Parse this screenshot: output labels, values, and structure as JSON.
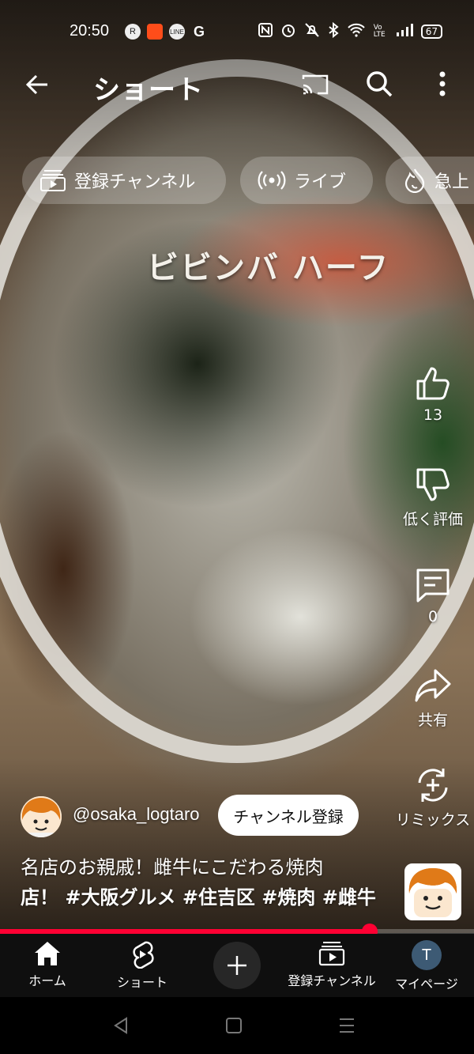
{
  "status_bar": {
    "time": "20:50",
    "app_icons": [
      "R",
      "",
      "LINE",
      "G"
    ],
    "network": "Vo LTE",
    "battery": "67"
  },
  "header": {
    "title": "ショート",
    "icons": [
      "back-arrow-icon",
      "cast-icon",
      "search-icon",
      "more-vert-icon"
    ]
  },
  "chips": [
    {
      "label": "登録チャンネル",
      "icon": "subscriptions-icon"
    },
    {
      "label": "ライブ",
      "icon": "live-icon"
    },
    {
      "label": "急上",
      "icon": "trending-icon"
    }
  ],
  "video": {
    "caption": "ビビンバ ハーフ"
  },
  "actions": {
    "like": {
      "label": "13",
      "icon": "thumbs-up-icon"
    },
    "dislike": {
      "label": "低く評価",
      "icon": "thumbs-down-icon"
    },
    "comments": {
      "label": "0",
      "icon": "comment-icon"
    },
    "share": {
      "label": "共有",
      "icon": "share-icon"
    },
    "remix": {
      "label": "リミックス",
      "icon": "remix-icon"
    }
  },
  "channel": {
    "handle": "@osaka_logtaro",
    "subscribe_label": "チャンネル登録"
  },
  "description": {
    "line1": "名店のお親戚！雌牛にこだわる焼肉",
    "line2": "店！ #大阪グルメ #住吉区 #焼肉 #雌牛"
  },
  "progress": {
    "fraction": 0.78
  },
  "bottom_nav": [
    {
      "label": "ホーム",
      "icon": "home-icon"
    },
    {
      "label": "ショート",
      "icon": "shorts-icon"
    },
    {
      "label": "",
      "icon": "plus-icon"
    },
    {
      "label": "登録チャンネル",
      "icon": "subscriptions-icon"
    },
    {
      "label": "マイページ",
      "icon": "avatar",
      "initial": "T"
    }
  ],
  "colors": {
    "accent": "#ff0033",
    "nav_bg": "#0f0f0f",
    "avatar_bg": "#3d5a74"
  }
}
